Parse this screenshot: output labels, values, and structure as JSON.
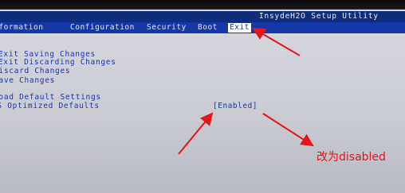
{
  "window": {
    "title": "InsydeH2O Setup Utility"
  },
  "menu": {
    "items": [
      {
        "label": "Information"
      },
      {
        "label": "Configuration"
      },
      {
        "label": "Security"
      },
      {
        "label": "Boot"
      },
      {
        "label": "Exit"
      }
    ]
  },
  "options": [
    {
      "label": "Exit Saving Changes"
    },
    {
      "label": "Exit Discarding Changes"
    },
    {
      "label": "Discard Changes"
    },
    {
      "label": "Save Changes"
    },
    {
      "label": "Load Default Settings"
    },
    {
      "label": "OS Optimized Defaults",
      "value": "[Enabled]"
    }
  ],
  "annotation": {
    "text": "改为disabled",
    "color": "#e8141c"
  },
  "colors": {
    "bios_blue": "#1538a8",
    "title_bar": "#0f2d7a",
    "screen_bg": "#d2d3da"
  }
}
